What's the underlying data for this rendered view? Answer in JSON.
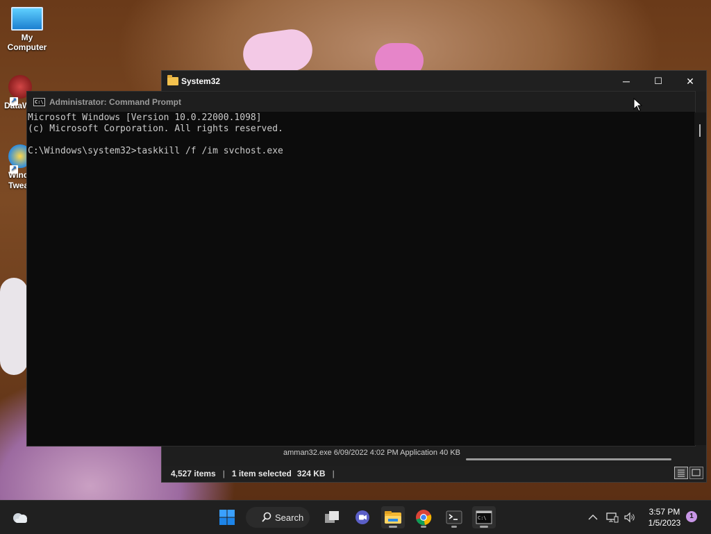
{
  "desktop": {
    "icons": [
      {
        "label": "My\nComputer"
      },
      {
        "label": "DataW"
      },
      {
        "label": "Wind\nTwea"
      }
    ]
  },
  "explorer": {
    "title": "System32",
    "controls": {
      "minimize": "─",
      "maximize": "☐",
      "close": "✕"
    },
    "partial_row": "amman32.exe                       6/09/2022 4:02 PM          Application                 40 KB",
    "status": {
      "items_count": "4,527 items",
      "selected": "1 item selected",
      "size": "324 KB"
    }
  },
  "cmd": {
    "title": "Administrator: Command Prompt",
    "lines": [
      "Microsoft Windows [Version 10.0.22000.1098]",
      "(c) Microsoft Corporation. All rights reserved.",
      "",
      "C:\\Windows\\system32>taskkill /f /im svchost.exe"
    ]
  },
  "taskbar": {
    "search_label": "Search",
    "apps": [
      {
        "name": "Task View"
      },
      {
        "name": "Teams Chat"
      },
      {
        "name": "File Explorer"
      },
      {
        "name": "Google Chrome"
      },
      {
        "name": "Terminal"
      },
      {
        "name": "Command Prompt"
      }
    ],
    "clock": {
      "time": "3:57 PM",
      "date": "1/5/2023"
    },
    "notification_count": "1"
  },
  "colors": {
    "accent": "#0078d4",
    "console_bg": "#0c0c0c",
    "console_text": "#cccccc",
    "taskbar_bg": "#202020"
  }
}
